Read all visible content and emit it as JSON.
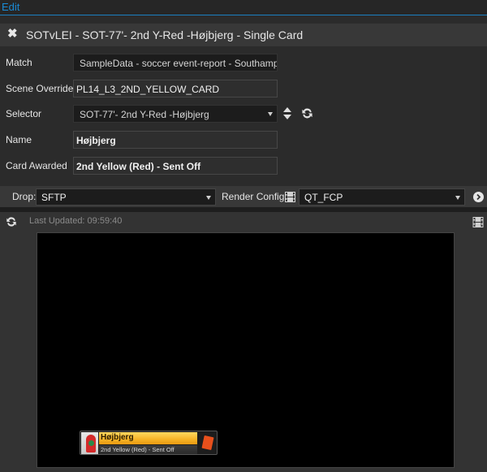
{
  "topbar": {
    "edit_label": "Edit"
  },
  "title": {
    "text": "SOTvLEI - SOT-77'- 2nd Y-Red -Højbjerg - Single Card"
  },
  "form": {
    "match": {
      "label": "Match",
      "value": "SampleData - soccer event-report - Southamp..."
    },
    "scene_override": {
      "label": "Scene Override",
      "value": "PL14_L3_2ND_YELLOW_CARD"
    },
    "selector": {
      "label": "Selector",
      "value": "SOT-77'- 2nd Y-Red -Højbjerg"
    },
    "name": {
      "label": "Name",
      "value": "Højbjerg"
    },
    "card_awarded": {
      "label": "Card Awarded",
      "value": "2nd Yellow (Red) - Sent Off"
    }
  },
  "dropbar": {
    "drop_label": "Drop:",
    "drop_value": "SFTP",
    "render_label": "Render Config:",
    "render_value": "QT_FCP"
  },
  "preview": {
    "last_updated": "Last Updated: 09:59:40",
    "graphic": {
      "name": "Højbjerg",
      "subtitle": "2nd Yellow (Red) - Sent Off",
      "card_color": "#e8501c",
      "bar_color": "#f5b225"
    }
  },
  "colors": {
    "accent": "#1a8ad4"
  }
}
